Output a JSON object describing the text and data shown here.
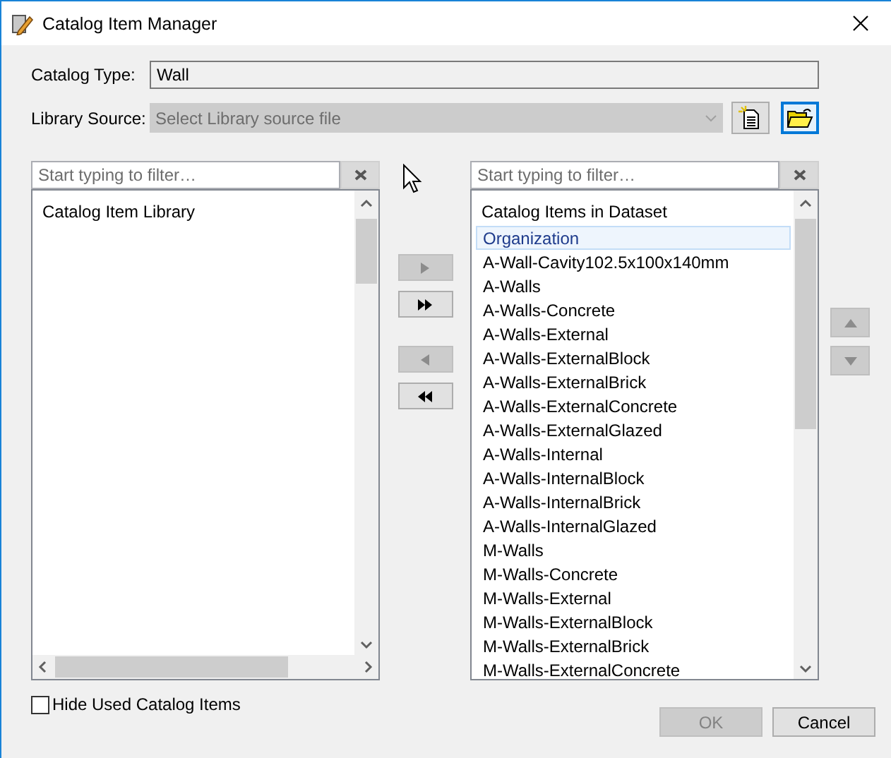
{
  "window": {
    "title": "Catalog Item Manager"
  },
  "catalog_type": {
    "label": "Catalog Type:",
    "value": "Wall"
  },
  "library_source": {
    "label": "Library Source:",
    "placeholder": "Select Library source file",
    "disabled": true
  },
  "source_buttons": [
    {
      "kind": "new",
      "focused": false
    },
    {
      "kind": "open",
      "focused": true
    }
  ],
  "library_panel": {
    "filter_placeholder": "Start typing to filter…",
    "header": "Catalog Item Library"
  },
  "transfer_buttons": [
    {
      "kind": "add",
      "disabled": true
    },
    {
      "kind": "add_all",
      "disabled": false
    },
    {
      "kind": "remove",
      "disabled": true
    },
    {
      "kind": "remove_all",
      "disabled": false
    }
  ],
  "dataset_panel": {
    "filter_placeholder": "Start typing to filter…",
    "header": "Catalog Items in Dataset",
    "items": [
      {
        "label": "Organization",
        "selected": true
      },
      {
        "label": "A-Wall-Cavity102.5x100x140mm",
        "selected": false
      },
      {
        "label": "A-Walls",
        "selected": false
      },
      {
        "label": "A-Walls-Concrete",
        "selected": false
      },
      {
        "label": "A-Walls-External",
        "selected": false
      },
      {
        "label": "A-Walls-ExternalBlock",
        "selected": false
      },
      {
        "label": "A-Walls-ExternalBrick",
        "selected": false
      },
      {
        "label": "A-Walls-ExternalConcrete",
        "selected": false
      },
      {
        "label": "A-Walls-ExternalGlazed",
        "selected": false
      },
      {
        "label": "A-Walls-Internal",
        "selected": false
      },
      {
        "label": "A-Walls-InternalBlock",
        "selected": false
      },
      {
        "label": "A-Walls-InternalBrick",
        "selected": false
      },
      {
        "label": "A-Walls-InternalGlazed",
        "selected": false
      },
      {
        "label": "M-Walls",
        "selected": false
      },
      {
        "label": "M-Walls-Concrete",
        "selected": false
      },
      {
        "label": "M-Walls-External",
        "selected": false
      },
      {
        "label": "M-Walls-ExternalBlock",
        "selected": false
      },
      {
        "label": "M-Walls-ExternalBrick",
        "selected": false
      },
      {
        "label": "M-Walls-ExternalConcrete",
        "selected": false
      }
    ]
  },
  "order_buttons": [
    {
      "kind": "up",
      "disabled": true
    },
    {
      "kind": "down",
      "disabled": true
    }
  ],
  "hide_used": {
    "label": "Hide Used Catalog Items",
    "checked": false
  },
  "buttons": [
    {
      "label": "OK",
      "disabled": true
    },
    {
      "label": "Cancel",
      "disabled": false
    }
  ]
}
